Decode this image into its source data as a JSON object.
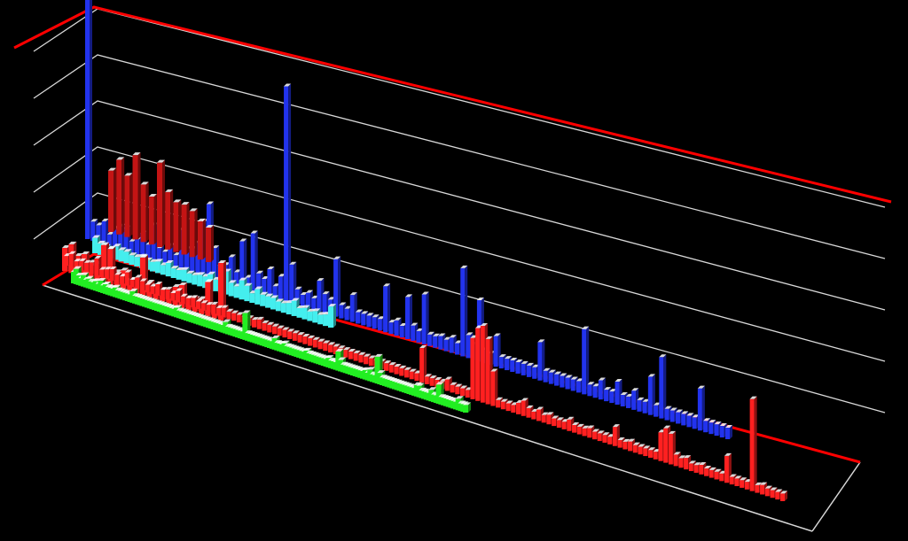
{
  "chart_data": {
    "type": "bar",
    "subtype": "3d-column",
    "background": "#000000",
    "grid": true,
    "legend": "none",
    "frame_color": "#ff0000",
    "grid_color": "#d8d8d8",
    "ylim": [
      0,
      6
    ],
    "series": [
      {
        "color": "#ff2020",
        "values": [
          0.25,
          0.35,
          0.2,
          0.25,
          0.25,
          0.3,
          0.45,
          0.2,
          0.25,
          0.3,
          0.2,
          0.2,
          0.35,
          0.2,
          0.3,
          0.25,
          0.2,
          0.2,
          0.3,
          0.2,
          0.25,
          0.2,
          0.3,
          0.2,
          0.2,
          0.25,
          0.2,
          0.2,
          0.2,
          0.25,
          0.2,
          0.25,
          0.2,
          0.2,
          0.2,
          0.2,
          0.2,
          0.2,
          0.25,
          0.2,
          0.2,
          0.2,
          0.2,
          0.2,
          0.2,
          0.2,
          0.2,
          0.2,
          0.2,
          0.2,
          0.2,
          0.2,
          0.2,
          0.2,
          0.2,
          0.2,
          0.2,
          0.2,
          0.2,
          0.2,
          0.2,
          0.2,
          0.2,
          0.2,
          0.2,
          0.2,
          0.2,
          0.2,
          0.2,
          0.2,
          0.9,
          0.2,
          0.2,
          0.2,
          0.2,
          0.3,
          0.2,
          0.2,
          0.2,
          0.2,
          1.6,
          1.9,
          2.0,
          1.7,
          0.9,
          0.2,
          0.2,
          0.2,
          0.2,
          0.3,
          0.4,
          0.25,
          0.2,
          0.3,
          0.2,
          0.25,
          0.2,
          0.2,
          0.2,
          0.3,
          0.2,
          0.2,
          0.2,
          0.25,
          0.2,
          0.2,
          0.2,
          0.2,
          0.5,
          0.2,
          0.2,
          0.25,
          0.2,
          0.2,
          0.2,
          0.2,
          0.2,
          0.75,
          0.9,
          0.8,
          0.3,
          0.25,
          0.3,
          0.2,
          0.2,
          0.25,
          0.2,
          0.2,
          0.2,
          0.2,
          0.7,
          0.2,
          0.2,
          0.2,
          0.2,
          2.4,
          0.2,
          0.25,
          0.2,
          0.2,
          0.2,
          0.2
        ]
      },
      {
        "color": "#ff2020",
        "values": [
          0.6,
          0.75,
          0.5,
          0.6,
          0.35,
          0.45,
          1.0,
          0.95,
          0.4,
          0.5,
          0.3,
          0.35,
          1.0,
          0.4,
          0.35,
          0.3,
          0.3,
          0.5,
          0.6,
          0.3,
          0.35,
          0.4,
          0.9,
          0.3,
          1.5
        ]
      },
      {
        "color": "#22ee22",
        "values": [
          0.3,
          0.4,
          0.25,
          0.2,
          0.3,
          0.2,
          0.25,
          0.2,
          0.2,
          0.25,
          0.2,
          0.3,
          0.2,
          0.25,
          0.2,
          0.2,
          0.2,
          0.25,
          0.2,
          0.2,
          0.2,
          0.2,
          0.2,
          0.2,
          0.3,
          0.2,
          0.2,
          0.2,
          0.2,
          0.2,
          0.2,
          0.2,
          0.2,
          0.2,
          0.2,
          0.2,
          0.2,
          0.2,
          0.2,
          0.2,
          0.2,
          0.2,
          0.25,
          0.2,
          0.2,
          0.2,
          0.2,
          0.2,
          0.2,
          0.2,
          0.2,
          0.2,
          0.2,
          0.2,
          0.2,
          0.2,
          0.2,
          0.2,
          0.2,
          0.2,
          0.2,
          0.2,
          0.3,
          0.2,
          0.2,
          0.2,
          0.2,
          0.2,
          0.2,
          0.2,
          0.7,
          0.2,
          0.2,
          0.2,
          0.2,
          0.2,
          0.2,
          0.2,
          0.2,
          0.2,
          0.2,
          0.2,
          0.3,
          0.2,
          0.2,
          0.2,
          0.25,
          0.2,
          0.2,
          0.2,
          0.2,
          0.2,
          0.2,
          0.2,
          0.2,
          0.25,
          0.2,
          0.2,
          0.2,
          0.2,
          0.2,
          0.2,
          0.2,
          0.2,
          0.25,
          0.2,
          0.2,
          0.2,
          0.5,
          0.3,
          0.2,
          0.2,
          0.2,
          0.2,
          0.2,
          0.2,
          0.2,
          0.2,
          0.2,
          0.25,
          0.2,
          0.3,
          0.2,
          0.2,
          0.7,
          0.3,
          0.2,
          0.2,
          0.2,
          0.2,
          0.2,
          0.2,
          0.2,
          0.2,
          0.2,
          0.2,
          0.2,
          0.2,
          0.2,
          0.2,
          0.3,
          0.3,
          0.2,
          0.2,
          0.2,
          0.2,
          0.3,
          0.2,
          0.2,
          0.5,
          0.2,
          0.2,
          0.2,
          0.2,
          0.2,
          0.2,
          0.2,
          0.3,
          0.2,
          0.2,
          0.2
        ]
      },
      {
        "color": "#44eeee",
        "values": [
          0.4,
          0.3,
          0.25,
          0.25,
          0.35,
          0.3,
          0.3,
          0.25,
          0.25,
          0.3,
          0.25,
          0.25,
          0.3,
          0.25,
          0.35,
          0.25,
          0.25,
          0.3,
          0.25,
          0.25,
          0.3,
          0.3,
          0.4,
          0.3,
          0.25,
          0.6,
          0.35,
          0.3,
          0.5,
          0.4,
          0.25,
          0.4,
          0.3,
          0.3,
          0.3,
          0.25,
          0.25,
          0.3,
          0.4,
          0.25,
          0.3,
          0.25,
          0.3,
          0.25,
          0.3,
          0.55
        ]
      },
      {
        "color": "#c41414",
        "values": [
          1.6,
          1.95,
          1.6,
          2.2,
          1.5,
          1.25,
          2.2,
          1.5,
          1.3,
          1.3,
          1.2,
          1.0,
          0.9
        ]
      },
      {
        "color": "#2233ee",
        "values": [
          6.3,
          0.5,
          0.45,
          0.6,
          0.3,
          0.5,
          0.6,
          0.6,
          0.3,
          0.4,
          0.6,
          0.35,
          0.9,
          0.35,
          0.3,
          0.5,
          0.3,
          1.0,
          0.55,
          0.6,
          0.8,
          1.4,
          1.9,
          0.8,
          0.4,
          0.45,
          0.7,
          0.35,
          1.2,
          0.3,
          1.5,
          0.5,
          0.4,
          0.7,
          0.3,
          0.6,
          5.6,
          1.0,
          0.4,
          0.3,
          0.4,
          0.3,
          0.8,
          0.5,
          0.4,
          1.5,
          0.35,
          0.3,
          0.7,
          0.3,
          0.3,
          0.3,
          0.3,
          0.3,
          1.2,
          0.3,
          0.4,
          0.3,
          1.1,
          0.4,
          0.3,
          1.3,
          0.3,
          0.3,
          0.35,
          0.3,
          0.4,
          0.3,
          2.3,
          0.6,
          0.4,
          1.6,
          0.35,
          0.3,
          0.8,
          0.3,
          0.3,
          0.3,
          0.3,
          0.3,
          0.3,
          0.3,
          1.0,
          0.3,
          0.3,
          0.3,
          0.3,
          0.3,
          0.3,
          0.3,
          1.7,
          0.3,
          0.3,
          0.5,
          0.3,
          0.3,
          0.6,
          0.3,
          0.3,
          0.5,
          0.3,
          0.3,
          1.0,
          0.3,
          1.6,
          0.3,
          0.3,
          0.3,
          0.3,
          0.3,
          0.3,
          1.1,
          0.3,
          0.3,
          0.3,
          0.3,
          0.3
        ]
      }
    ]
  }
}
